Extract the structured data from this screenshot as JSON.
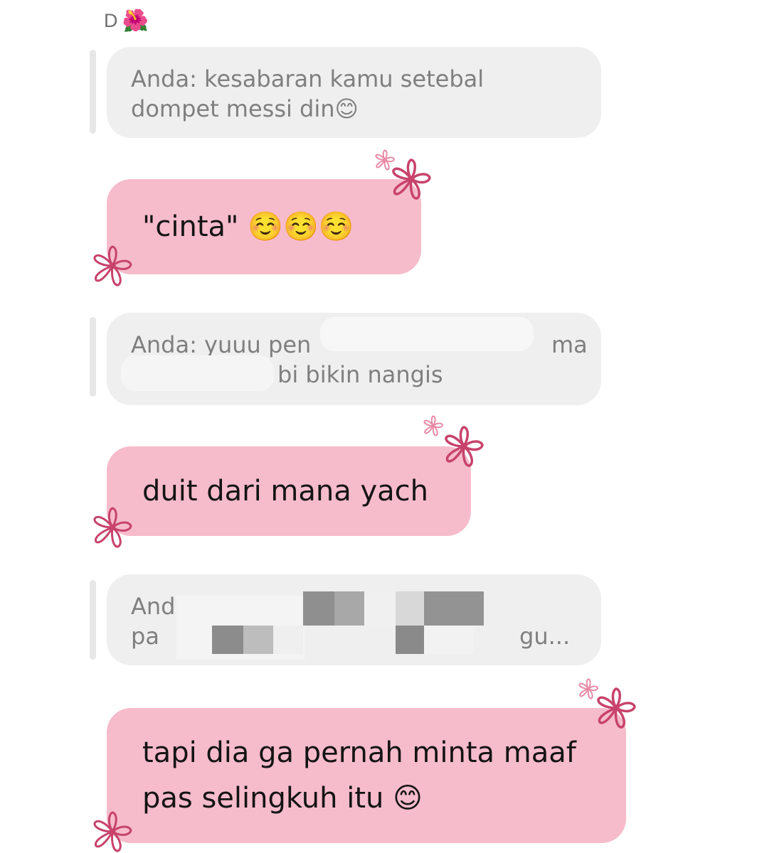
{
  "header": {
    "initial": "D",
    "flower_emoji": "🌺"
  },
  "messages": [
    {
      "kind": "reply",
      "lines": [
        "Anda: kesabaran kamu setebal",
        "dompet messi din😊"
      ]
    },
    {
      "kind": "sent",
      "lines": [
        "\"cinta\" ☺️☺️☺️"
      ]
    },
    {
      "kind": "reply",
      "lines": [
        "Anda: yuuu pen",
        "bi bikin nangis"
      ],
      "partial_line1_end": "ma",
      "redacted": true
    },
    {
      "kind": "sent",
      "lines": [
        "duit dari mana yach"
      ]
    },
    {
      "kind": "reply",
      "lines": [
        "Anda: aku",
        "pa"
      ],
      "partial_line2_tail": "gu...",
      "redacted": true
    },
    {
      "kind": "sent",
      "lines": [
        "tapi dia ga pernah minta maaf",
        "pas selingkuh itu 😊"
      ]
    }
  ],
  "colors": {
    "reply_bg": "#efefef",
    "reply_text": "#7f7f7f",
    "sent_bg": "#f6bccb",
    "sent_text": "#141414",
    "flower_stroke": "#c8436b",
    "flower_small_stroke": "#e88aa6"
  },
  "icons": {
    "flower": "flower-doodle-icon",
    "sticker": "hibiscus-emoji"
  }
}
